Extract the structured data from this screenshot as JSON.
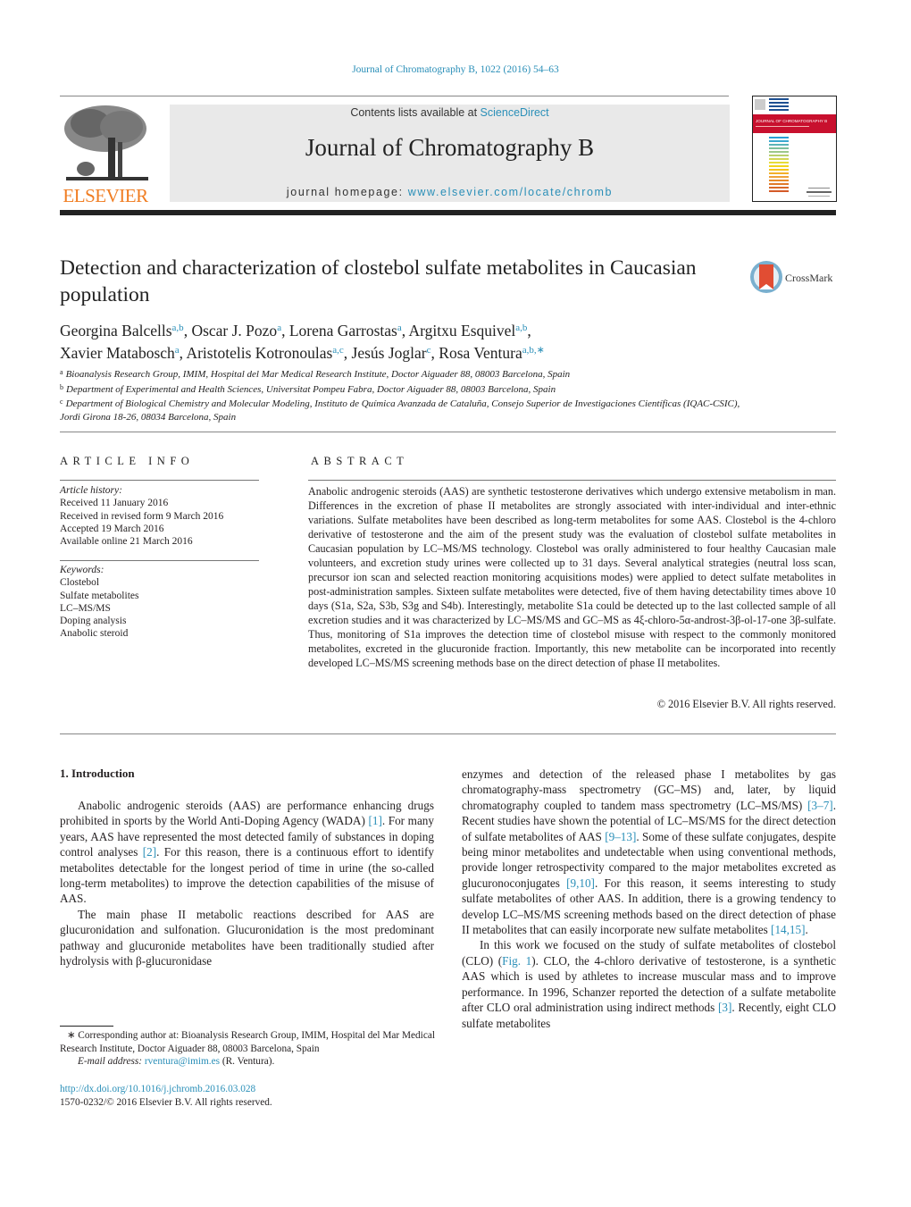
{
  "journal_ref": "Journal of Chromatography B, 1022 (2016) 54–63",
  "header": {
    "publisher_logo_text": "ELSEVIER",
    "contents_prefix": "Contents lists available at ",
    "contents_link": "ScienceDirect",
    "journal_title": "Journal of Chromatography B",
    "homepage_prefix": "journal homepage: ",
    "homepage_link": "www.elsevier.com/locate/chromb",
    "cover_title": "JOURNAL OF CHROMATOGRAPHY B",
    "crossmark_label": "CrossMark"
  },
  "article": {
    "title": "Detection and characterization of clostebol sulfate metabolites in Caucasian population",
    "authors": [
      {
        "name": "Georgina Balcells",
        "aff": "a,b",
        "sep": ", "
      },
      {
        "name": "Oscar J. Pozo",
        "aff": "a",
        "sep": ", "
      },
      {
        "name": "Lorena Garrostas",
        "aff": "a",
        "sep": ", "
      },
      {
        "name": "Argitxu Esquivel",
        "aff": "a,b",
        "sep": ","
      },
      {
        "name": "Xavier Matabosch",
        "aff": "a",
        "sep": ", "
      },
      {
        "name": "Aristotelis Kotronoulas",
        "aff": "a,c",
        "sep": ", "
      },
      {
        "name": "Jesús Joglar",
        "aff": "c",
        "sep": ", "
      },
      {
        "name": "Rosa Ventura",
        "aff": "a,b,∗",
        "sep": ""
      }
    ],
    "affiliations": [
      {
        "label": "a",
        "text": "Bioanalysis Research Group, IMIM, Hospital del Mar Medical Research Institute, Doctor Aiguader 88, 08003 Barcelona, Spain"
      },
      {
        "label": "b",
        "text": "Department of Experimental and Health Sciences, Universitat Pompeu Fabra, Doctor Aiguader 88, 08003 Barcelona, Spain"
      },
      {
        "label": "c",
        "text": "Department of Biological Chemistry and Molecular Modeling, Instituto de Química Avanzada de Cataluña, Consejo Superior de Investigaciones Científicas (IQAC-CSIC), Jordi Girona 18-26, 08034 Barcelona, Spain"
      }
    ]
  },
  "article_info": {
    "heading": "ARTICLE INFO",
    "history_label": "Article history:",
    "history": [
      "Received 11 January 2016",
      "Received in revised form 9 March 2016",
      "Accepted 19 March 2016",
      "Available online 21 March 2016"
    ],
    "keywords_label": "Keywords:",
    "keywords": [
      "Clostebol",
      "Sulfate metabolites",
      "LC–MS/MS",
      "Doping analysis",
      "Anabolic steroid"
    ]
  },
  "abstract": {
    "heading": "ABSTRACT",
    "text": "Anabolic androgenic steroids (AAS) are synthetic testosterone derivatives which undergo extensive metabolism in man. Differences in the excretion of phase II metabolites are strongly associated with inter-individual and inter-ethnic variations. Sulfate metabolites have been described as long-term metabolites for some AAS. Clostebol is the 4-chloro derivative of testosterone and the aim of the present study was the evaluation of clostebol sulfate metabolites in Caucasian population by LC–MS/MS technology. Clostebol was orally administered to four healthy Caucasian male volunteers, and excretion study urines were collected up to 31 days. Several analytical strategies (neutral loss scan, precursor ion scan and selected reaction monitoring acquisitions modes) were applied to detect sulfate metabolites in post-administration samples. Sixteen sulfate metabolites were detected, five of them having detectability times above 10 days (S1a, S2a, S3b, S3g and S4b). Interestingly, metabolite S1a could be detected up to the last collected sample of all excretion studies and it was characterized by LC–MS/MS and GC–MS as 4ξ-chloro-5α-androst-3β-ol-17-one 3β-sulfate. Thus, monitoring of S1a improves the detection time of clostebol misuse with respect to the commonly monitored metabolites, excreted in the glucuronide fraction. Importantly, this new metabolite can be incorporated into recently developed LC–MS/MS screening methods base on the direct detection of phase II metabolites.",
    "copyright": "© 2016 Elsevier B.V. All rights reserved."
  },
  "introduction": {
    "heading": "1.  Introduction",
    "left_paragraphs": [
      [
        {
          "t": "Anabolic androgenic steroids (AAS) are performance enhancing drugs prohibited in sports by the World Anti-Doping Agency (WADA) "
        },
        {
          "ref": "[1]"
        },
        {
          "t": ". For many years, AAS have represented the most detected family of substances in doping control analyses "
        },
        {
          "ref": "[2]"
        },
        {
          "t": ". For this reason, there is a continuous effort to identify metabolites detectable for the longest period of time in urine (the so-called long-term metabolites) to improve the detection capabilities of the misuse of AAS."
        }
      ],
      [
        {
          "t": "The main phase II metabolic reactions described for AAS are glucuronidation and sulfonation. Glucuronidation is the most predominant pathway and glucuronide metabolites have been traditionally studied after hydrolysis with β-glucuronidase"
        }
      ]
    ],
    "right_paragraphs": [
      [
        {
          "t": "enzymes and detection of the released phase I metabolites by gas chromatography-mass spectrometry (GC–MS) and, later, by liquid chromatography coupled to tandem mass spectrometry (LC–MS/MS) "
        },
        {
          "ref": "[3–7]"
        },
        {
          "t": ". Recent studies have shown the potential of LC–MS/MS for the direct detection of sulfate metabolites of AAS "
        },
        {
          "ref": "[9–13]"
        },
        {
          "t": ". Some of these sulfate conjugates, despite being minor metabolites and undetectable when using conventional methods, provide longer retrospectivity compared to the major metabolites excreted as glucuronoconjugates "
        },
        {
          "ref": "[9,10]"
        },
        {
          "t": ". For this reason, it seems interesting to study sulfate metabolites of other AAS. In addition, there is a growing tendency to develop LC–MS/MS screening methods based on the direct detection of phase II metabolites that can easily incorporate new sulfate metabolites "
        },
        {
          "ref": "[14,15]"
        },
        {
          "t": "."
        }
      ],
      [
        {
          "t": "In this work we focused on the study of sulfate metabolites of clostebol (CLO) ("
        },
        {
          "ref": "Fig. 1"
        },
        {
          "t": "). CLO, the 4-chloro derivative of testosterone, is a synthetic AAS which is used by athletes to increase muscular mass and to improve performance. In 1996, Schanzer reported the detection of a sulfate metabolite after CLO oral administration using indirect methods "
        },
        {
          "ref": "[3]"
        },
        {
          "t": ". Recently, eight CLO sulfate metabolites"
        }
      ]
    ]
  },
  "footnote": {
    "corresponding": "∗ Corresponding author at: Bioanalysis Research Group, IMIM, Hospital del Mar Medical Research Institute, Doctor Aiguader 88, 08003 Barcelona, Spain",
    "email_label": "E-mail address:",
    "email": "rventura@imim.es",
    "email_suffix": " (R. Ventura).",
    "doi": "http://dx.doi.org/10.1016/j.jchromb.2016.03.028",
    "issn_line": "1570-0232/© 2016 Elsevier B.V. All rights reserved."
  },
  "colors": {
    "link": "#2a8fb8",
    "elsevier_orange": "#f07d22",
    "header_box": "#e9e9e9"
  }
}
